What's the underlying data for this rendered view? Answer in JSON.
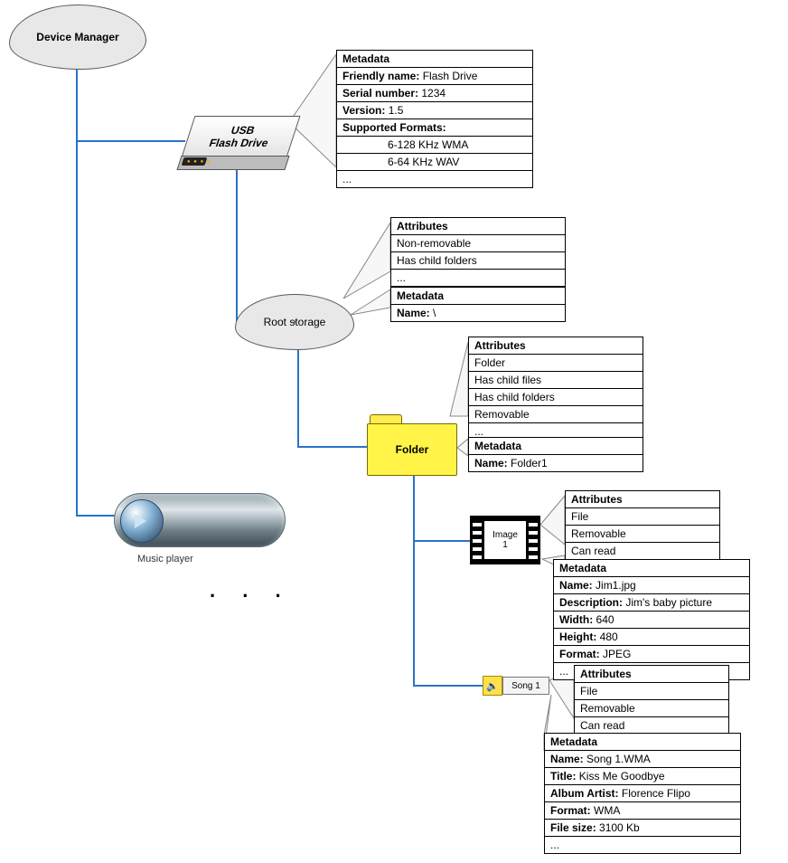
{
  "nodes": {
    "device_manager": "Device Manager",
    "usb": "USB\nFlash Drive",
    "root_storage": "Root storage",
    "folder": "Folder",
    "image1": "Image\n1",
    "song1": "Song 1",
    "music_player": "Music player",
    "ellipsis": ". . ."
  },
  "usb_metadata": {
    "header": "Metadata",
    "friendly_name_k": "Friendly name:",
    "friendly_name_v": " Flash Drive",
    "serial_k": "Serial number:",
    "serial_v": " 1234",
    "version_k": "Version:",
    "version_v": " 1.5",
    "formats_k": "Supported Formats:",
    "fmt1": "6-128 KHz WMA",
    "fmt2": "6-64 KHz WAV",
    "more": "..."
  },
  "root_attributes": {
    "header": "Attributes",
    "a1": "Non-removable",
    "a2": "Has child folders",
    "more": "..."
  },
  "root_metadata": {
    "header": "Metadata",
    "name_k": "Name:",
    "name_v": " \\"
  },
  "folder_attributes": {
    "header": "Attributes",
    "a1": "Folder",
    "a2": "Has child files",
    "a3": "Has child folders",
    "a4": "Removable",
    "more": "..."
  },
  "folder_metadata": {
    "header": "Metadata",
    "name_k": "Name:",
    "name_v": " Folder1"
  },
  "image_attributes": {
    "header": "Attributes",
    "a1": "File",
    "a2": "Removable",
    "a3": "Can read"
  },
  "image_metadata": {
    "header": "Metadata",
    "name_k": "Name:",
    "name_v": " Jim1.jpg",
    "desc_k": "Description:",
    "desc_v": " Jim's baby picture",
    "width_k": "Width:",
    "width_v": " 640",
    "height_k": "Height:",
    "height_v": " 480",
    "format_k": "Format:",
    "format_v": " JPEG",
    "more": "..."
  },
  "song_attributes": {
    "header": "Attributes",
    "a1": "File",
    "a2": "Removable",
    "a3": "Can read"
  },
  "song_metadata": {
    "header": "Metadata",
    "name_k": "Name:",
    "name_v": " Song 1.WMA",
    "title_k": "Title:",
    "title_v": " Kiss Me Goodbye",
    "artist_k": "Album Artist:",
    "artist_v": " Florence Flipo",
    "format_k": "Format:",
    "format_v": " WMA",
    "size_k": "File size:",
    "size_v": " 3100 Kb",
    "more": "..."
  }
}
